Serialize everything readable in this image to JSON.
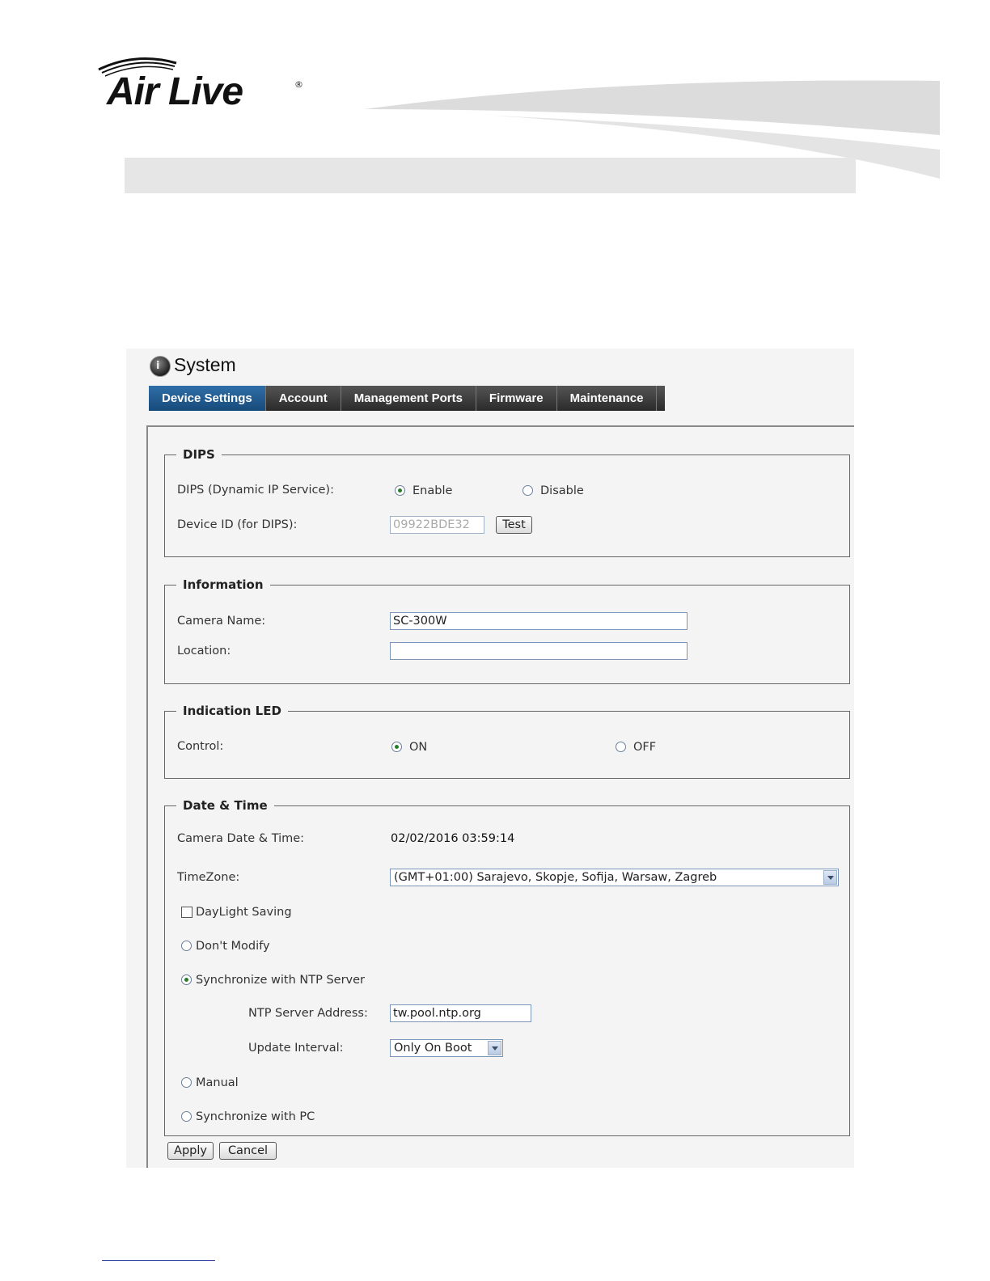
{
  "brand": {
    "logo_text": "Air Live",
    "registered": "®"
  },
  "page": {
    "title": "System"
  },
  "tabs": [
    {
      "label": "Device Settings",
      "active": true
    },
    {
      "label": "Account",
      "active": false
    },
    {
      "label": "Management Ports",
      "active": false
    },
    {
      "label": "Firmware",
      "active": false
    },
    {
      "label": "Maintenance",
      "active": false
    }
  ],
  "dips": {
    "legend": "DIPS",
    "service_label": "DIPS (Dynamic IP Service):",
    "enable_label": "Enable",
    "disable_label": "Disable",
    "selected": "Enable",
    "device_id_label": "Device ID (for DIPS):",
    "device_id_value": "09922BDE32",
    "test_label": "Test"
  },
  "information": {
    "legend": "Information",
    "camera_name_label": "Camera Name:",
    "camera_name_value": "SC-300W",
    "location_label": "Location:",
    "location_value": ""
  },
  "led": {
    "legend": "Indication LED",
    "control_label": "Control:",
    "on_label": "ON",
    "off_label": "OFF",
    "selected": "ON"
  },
  "datetime": {
    "legend": "Date & Time",
    "camera_dt_label": "Camera Date & Time:",
    "camera_dt_value": "02/02/2016 03:59:14",
    "timezone_label": "TimeZone:",
    "timezone_value": "(GMT+01:00) Sarajevo, Skopje, Sofija, Warsaw, Zagreb",
    "daylight_label": "DayLight Saving",
    "daylight_checked": false,
    "dont_modify_label": "Don't Modify",
    "ntp_label": "Synchronize with NTP Server",
    "ntp_address_label": "NTP Server Address:",
    "ntp_address_value": "tw.pool.ntp.org",
    "update_interval_label": "Update Interval:",
    "update_interval_value": "Only On Boot",
    "manual_label": "Manual",
    "pc_label": "Synchronize with PC",
    "selected_mode": "Synchronize with NTP Server"
  },
  "actions": {
    "apply_label": "Apply",
    "cancel_label": "Cancel"
  },
  "colors": {
    "tab_active": "#174a7a",
    "tab_bar": "#2a2a2a",
    "radio_dot": "#2b7a2b"
  }
}
